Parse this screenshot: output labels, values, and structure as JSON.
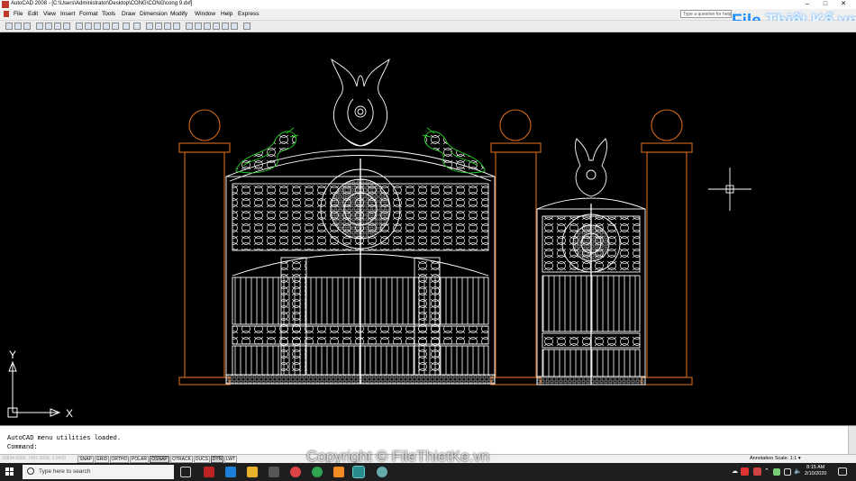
{
  "window": {
    "title": "AutoCAD 2008 - [C:\\Users\\Administrator\\Desktop\\CONG\\CONG\\cong 9.dxf]",
    "controls": [
      "–",
      "□",
      "✕"
    ]
  },
  "menu": {
    "items": [
      "File",
      "Edit",
      "View",
      "Insert",
      "Format",
      "Tools",
      "Draw",
      "Dimension",
      "Modify",
      "Window",
      "Help",
      "Express"
    ],
    "search_placeholder": "Type a question for help"
  },
  "watermark_logo": {
    "part1": "File",
    "part2": "Thiết Kế.vn"
  },
  "canvas": {
    "axis_x": "X",
    "axis_y": "Y",
    "colors": {
      "background": "#000000",
      "gate": "#ffffff",
      "pillar": "#d2691e",
      "dragon": "#22cc22",
      "crosshair": "#ffffff"
    }
  },
  "command": {
    "history": "AutoCAD menu utilities loaded.",
    "prompt": "Command:"
  },
  "status": {
    "coords": "33834.5000, 7491.5000, 0.0000",
    "toggles": [
      "SNAP",
      "GRID",
      "ORTHO",
      "POLAR",
      "OSNAP",
      "OTRACK",
      "DUCS",
      "DYN",
      "LWT"
    ],
    "toggles_on": [
      "OSNAP",
      "DYN"
    ],
    "annotation_label": "Annotation Scale:",
    "annotation_value": "1:1"
  },
  "taskbar": {
    "search_placeholder": "Type here to search",
    "time": "8:15 AM",
    "date": "2/10/2020"
  },
  "copyright": "Copyright © FileThietKe.vn"
}
